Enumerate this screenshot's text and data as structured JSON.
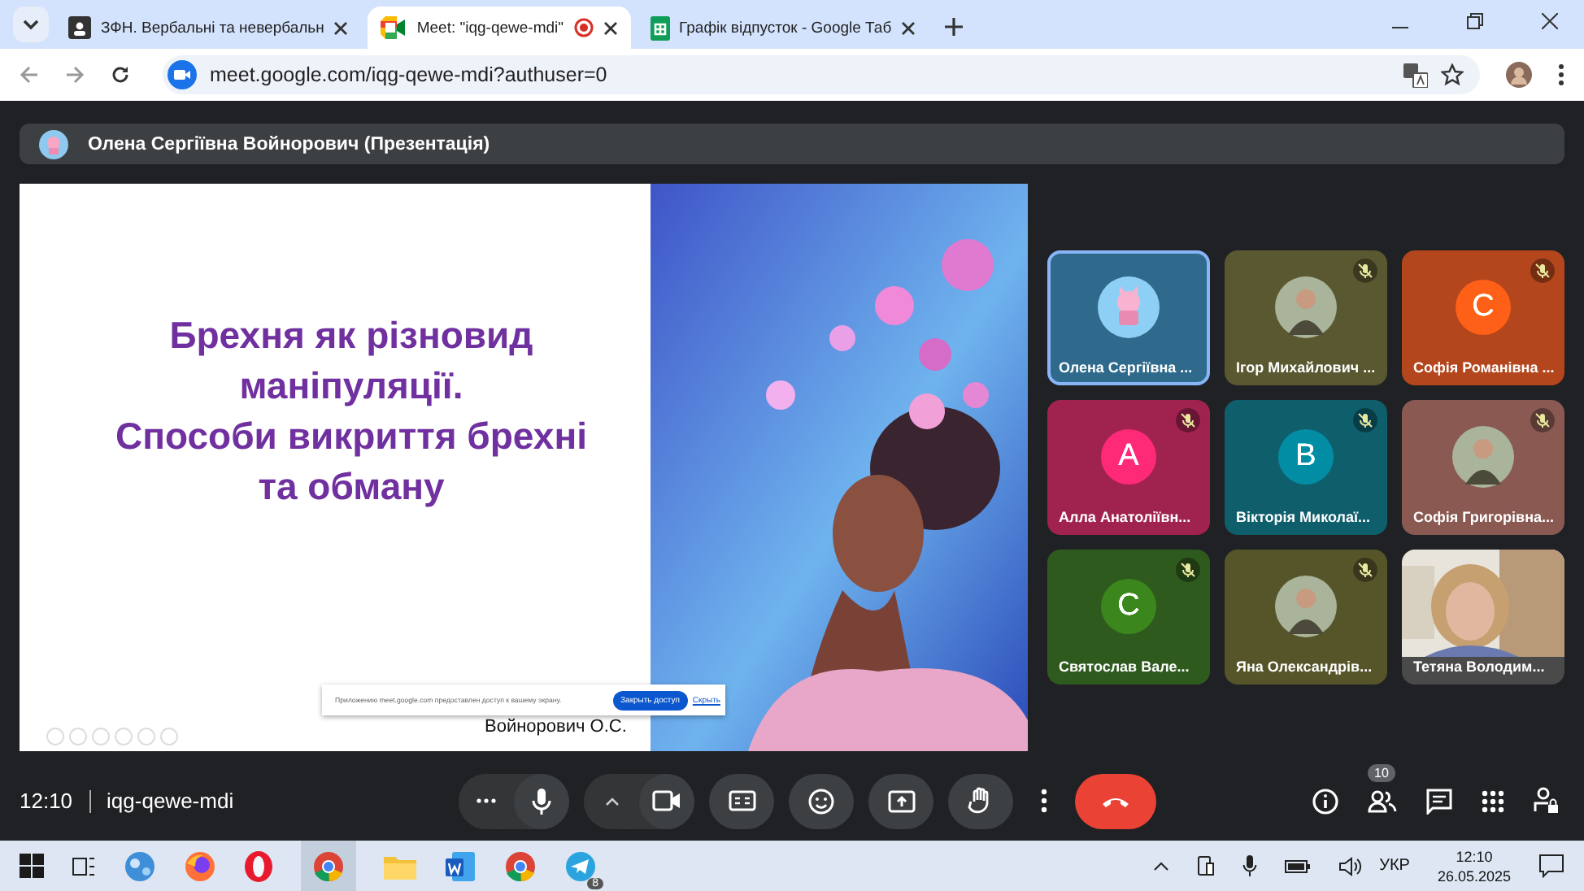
{
  "browser": {
    "tabs": [
      {
        "title": "ЗФН. Вербальні та невербальн",
        "kind": "classroom",
        "selected": false,
        "recording": false
      },
      {
        "title": "Meet: \"iqg-qewe-mdi\"",
        "kind": "meet",
        "selected": true,
        "recording": true
      },
      {
        "title": "Графік відпусток - Google Таб",
        "kind": "sheets",
        "selected": false,
        "recording": false
      }
    ],
    "url": "meet.google.com/iqg-qewe-mdi?authuser=0"
  },
  "presenter_bar": {
    "name": "Олена Сергіївна Войнорович (Презентація)"
  },
  "slide": {
    "title_lines": [
      "Брехня як різновид",
      "маніпуляції.",
      "Способи викриття брехні",
      "та обману"
    ],
    "author": "Войнорович О.С.",
    "share_notice": {
      "text": "Приложению meet.google.com предоставлен доступ к вашему экрану.",
      "stop_button": "Закрыть доступ",
      "hide_link": "Скрыть"
    }
  },
  "participants": [
    {
      "name": "Олена Сергіївна ...",
      "kind": "emoji",
      "color": "#2f6a8c",
      "muted": false,
      "selected": true
    },
    {
      "name": "Ігор Михайлович ...",
      "color": "#5a5830",
      "muted": true,
      "selected": false
    },
    {
      "name": "Софія Романівна ...",
      "kind": "letter",
      "initial": "С",
      "color": "#b3461c",
      "muted": true,
      "selected": false
    },
    {
      "name": "Алла Анатоліївн...",
      "kind": "letter",
      "initial": "А",
      "color": "#a0234f",
      "muted": true,
      "selected": false
    },
    {
      "name": "Вікторія Миколаї...",
      "kind": "letter",
      "initial": "В",
      "color": "#0f5e6c",
      "muted": true,
      "selected": false
    },
    {
      "name": "Софія Григорівна...",
      "color": "#8a5a52",
      "muted": true,
      "selected": false
    },
    {
      "name": "Святослав Вале...",
      "kind": "letter",
      "initial": "С",
      "color": "#2f5a1e",
      "muted": true,
      "selected": false
    },
    {
      "name": "Яна Олександрів...",
      "color": "#56552a",
      "muted": true,
      "selected": false
    },
    {
      "name": "Тетяна Володим...",
      "kind": "video",
      "color": "#4a4a4a",
      "muted": false,
      "selected": false
    }
  ],
  "controls": {
    "time": "12:10",
    "meeting_code": "iqg-qewe-mdi",
    "people_count": "10"
  },
  "taskbar": {
    "telegram_badge": "8",
    "language": "УКР",
    "time": "12:10",
    "date": "26.05.2025"
  }
}
